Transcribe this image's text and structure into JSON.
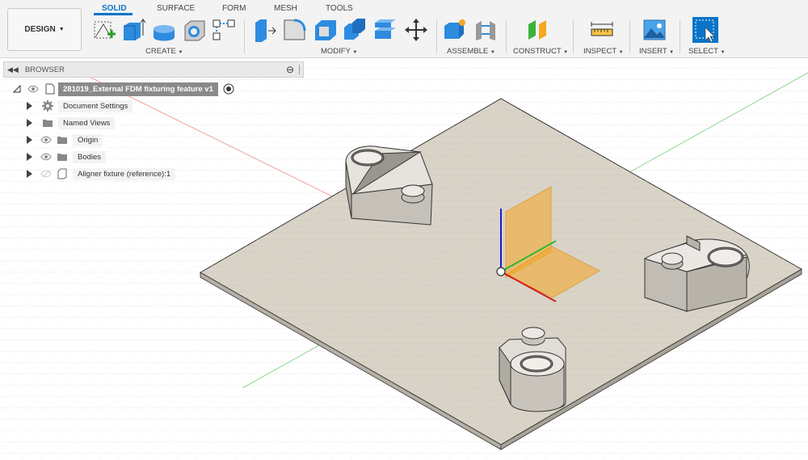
{
  "workspace": {
    "label": "DESIGN"
  },
  "tabs": [
    {
      "label": "SOLID"
    },
    {
      "label": "SURFACE"
    },
    {
      "label": "FORM"
    },
    {
      "label": "MESH"
    },
    {
      "label": "TOOLS"
    }
  ],
  "groups": {
    "create": "CREATE",
    "modify": "MODIFY",
    "assemble": "ASSEMBLE",
    "construct": "CONSTRUCT",
    "inspect": "INSPECT",
    "insert": "INSERT",
    "select": "SELECT"
  },
  "browser": {
    "title": "BROWSER",
    "root": "281019_External FDM fixturing feature v1",
    "items": [
      {
        "label": "Document Settings",
        "icon": "gear-icon"
      },
      {
        "label": "Named Views",
        "icon": "folder-icon"
      },
      {
        "label": "Origin",
        "icon": "folder-icon"
      },
      {
        "label": "Bodies",
        "icon": "folder-icon"
      },
      {
        "label": "Aligner fixture (reference):1",
        "icon": "component-icon"
      }
    ]
  },
  "colors": {
    "accent": "#0b74c8",
    "plate": "#d9d3c8",
    "part": "#e6e2dc",
    "origin_plane": "#f5a623"
  }
}
